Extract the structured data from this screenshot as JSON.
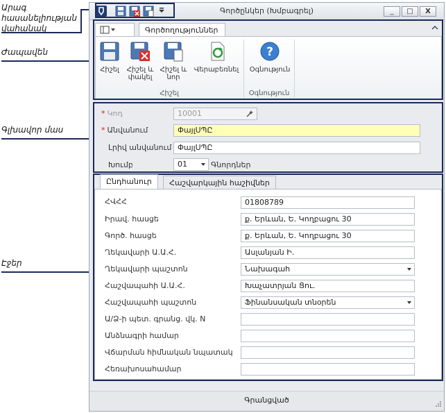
{
  "annotations": {
    "quick_access": [
      "Արագ",
      "հասանելիության",
      "վահանակ"
    ],
    "ribbon": "Ժապավեն",
    "main_part": "Գլխավոր մաս",
    "tabs": "Էջեր"
  },
  "window": {
    "title": "Գործընկեր (Խմբագրել)",
    "minimize": "_",
    "maximize": "□",
    "close": "X"
  },
  "ribbon": {
    "tab_label": "Գործողություններ",
    "buttons": {
      "save": [
        "Հիշել"
      ],
      "save_close": [
        "Հիշել և",
        "փակել"
      ],
      "save_new": [
        "Հիշել և",
        "նոր"
      ],
      "reload": [
        "Վերաբեռնել"
      ],
      "help": [
        "Օգնություն"
      ]
    },
    "groups": {
      "save": "Հիշել",
      "help": "Օգնություն"
    }
  },
  "header": {
    "code_label": "Կոդ",
    "code_value": "10001",
    "name_label": "Անվանում",
    "name_value": "ՓայլՍՊԸ",
    "fullname_label": "Լրիվ անվանում",
    "fullname_value": "ՓայլՍՊԸ",
    "group_label": "Խումբ",
    "group_value": "01",
    "group_desc": "Գնորդներ"
  },
  "tabs": {
    "general": "Ընդհանուր",
    "accounts": "Հաշվարկային հաշիվներ"
  },
  "form": {
    "tin_label": "ՀՎՀՀ",
    "tin_value": "01808789",
    "legal_addr_label": "Իրավ. հասցե",
    "legal_addr_value": "ք. Երևան, Ե. Կողբացու 30",
    "work_addr_label": "Գործ. հասցե",
    "work_addr_value": "ք. Երևան, Ե. Կողբացու 30",
    "director_name_label": "Ղեկավարի Ա.Ա.Հ.",
    "director_name_value": "Ասլանյան Ի.",
    "director_pos_label": "Ղեկավարի պաշտոն",
    "director_pos_value": "Նախագահ",
    "accountant_name_label": "Հաշվապահի Ա.Ա.Հ.",
    "accountant_name_value": "Խաչատրյան Ցու.",
    "accountant_pos_label": "Հաշվապահի պաշտոն",
    "accountant_pos_value": "Ֆինանսական տնօրեն",
    "reg_num_label": "Ա/Ձ-ի պետ. գրանց. վկ. N",
    "reg_num_value": "",
    "passport_label": "Անձնագրի համար",
    "passport_value": "",
    "bank_label": "Վճարման հիմնական նպատակ",
    "bank_value": "",
    "phone_label": "Հեռախոսահամար",
    "phone_value": ""
  },
  "status": {
    "text": "Գրանցված"
  }
}
